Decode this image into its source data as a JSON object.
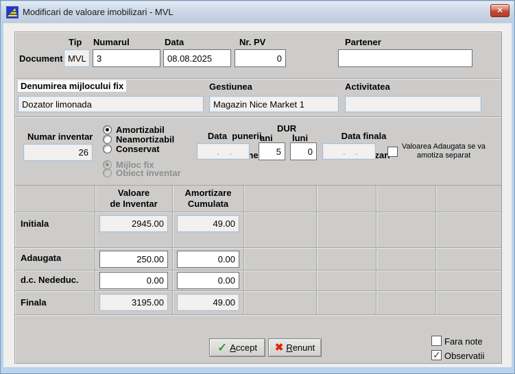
{
  "window": {
    "title": "Modificari de valoare imobilizari - MVL",
    "close_glyph": "✕"
  },
  "document": {
    "section_label": "Document",
    "tip_label": "Tip",
    "tip_value": "MVL",
    "numarul_label": "Numarul",
    "numarul_value": "3",
    "data_label": "Data",
    "data_value": "08.08.2025",
    "nrpv_label": "Nr. PV",
    "nrpv_value": "0",
    "partener_label": "Partener",
    "partener_value": ""
  },
  "asset": {
    "name_label": "Denumirea mijlocului fix",
    "name_value": "Dozator limonada",
    "gestiune_label": "Gestiunea",
    "gestiune_value": "Magazin Nice Market 1",
    "activitate_label": "Activitatea",
    "activitate_value": ""
  },
  "inventar": {
    "numar_label": "Numar inventar",
    "numar_value": "26",
    "status_options": [
      {
        "label": "Amortizabil",
        "selected": true
      },
      {
        "label": "Neamortizabil",
        "selected": false
      },
      {
        "label": "Conservat",
        "selected": false
      }
    ],
    "tip_options": [
      {
        "label": "Mijloc fix",
        "selected": true
      },
      {
        "label": "Obiect inventar",
        "selected": false
      }
    ],
    "data_punerii_line1": "Data  punerii",
    "data_punerii_line2": "in functiune",
    "data_punerii_value": " .    .",
    "dur_label": "DUR",
    "ani_label": "ani",
    "ani_value": "5",
    "luni_label": "luni",
    "luni_value": "0",
    "data_finala_line1": "Data finala",
    "data_finala_line2": "a amortizari",
    "data_finala_value": " .    .",
    "vat_note_line1": "Valoarea Adaugata se va",
    "vat_note_line2": "amotiza separat",
    "vat_checked": false
  },
  "table": {
    "col_valoare_line1": "Valoare",
    "col_valoare_line2": "de Inventar",
    "col_amortizare_line1": "Amortizare",
    "col_amortizare_line2": "Cumulata",
    "rows": [
      {
        "label": "Initiala",
        "valoare": "2945.00",
        "amortizare": "49.00",
        "readonly": true
      },
      {
        "label": "Adaugata",
        "valoare": "250.00",
        "amortizare": "0.00",
        "readonly": false
      },
      {
        "label": "d.c. Nededuc.",
        "valoare": "0.00",
        "amortizare": "0.00",
        "readonly": false
      },
      {
        "label": "Finala",
        "valoare": "3195.00",
        "amortizare": "49.00",
        "readonly": true
      }
    ]
  },
  "footer": {
    "accept_label": "Accept",
    "renunt_label": "Renunt",
    "fara_note_label": "Fara note",
    "fara_note_checked": false,
    "observatii_label": "Observatii",
    "observatii_checked": true
  }
}
